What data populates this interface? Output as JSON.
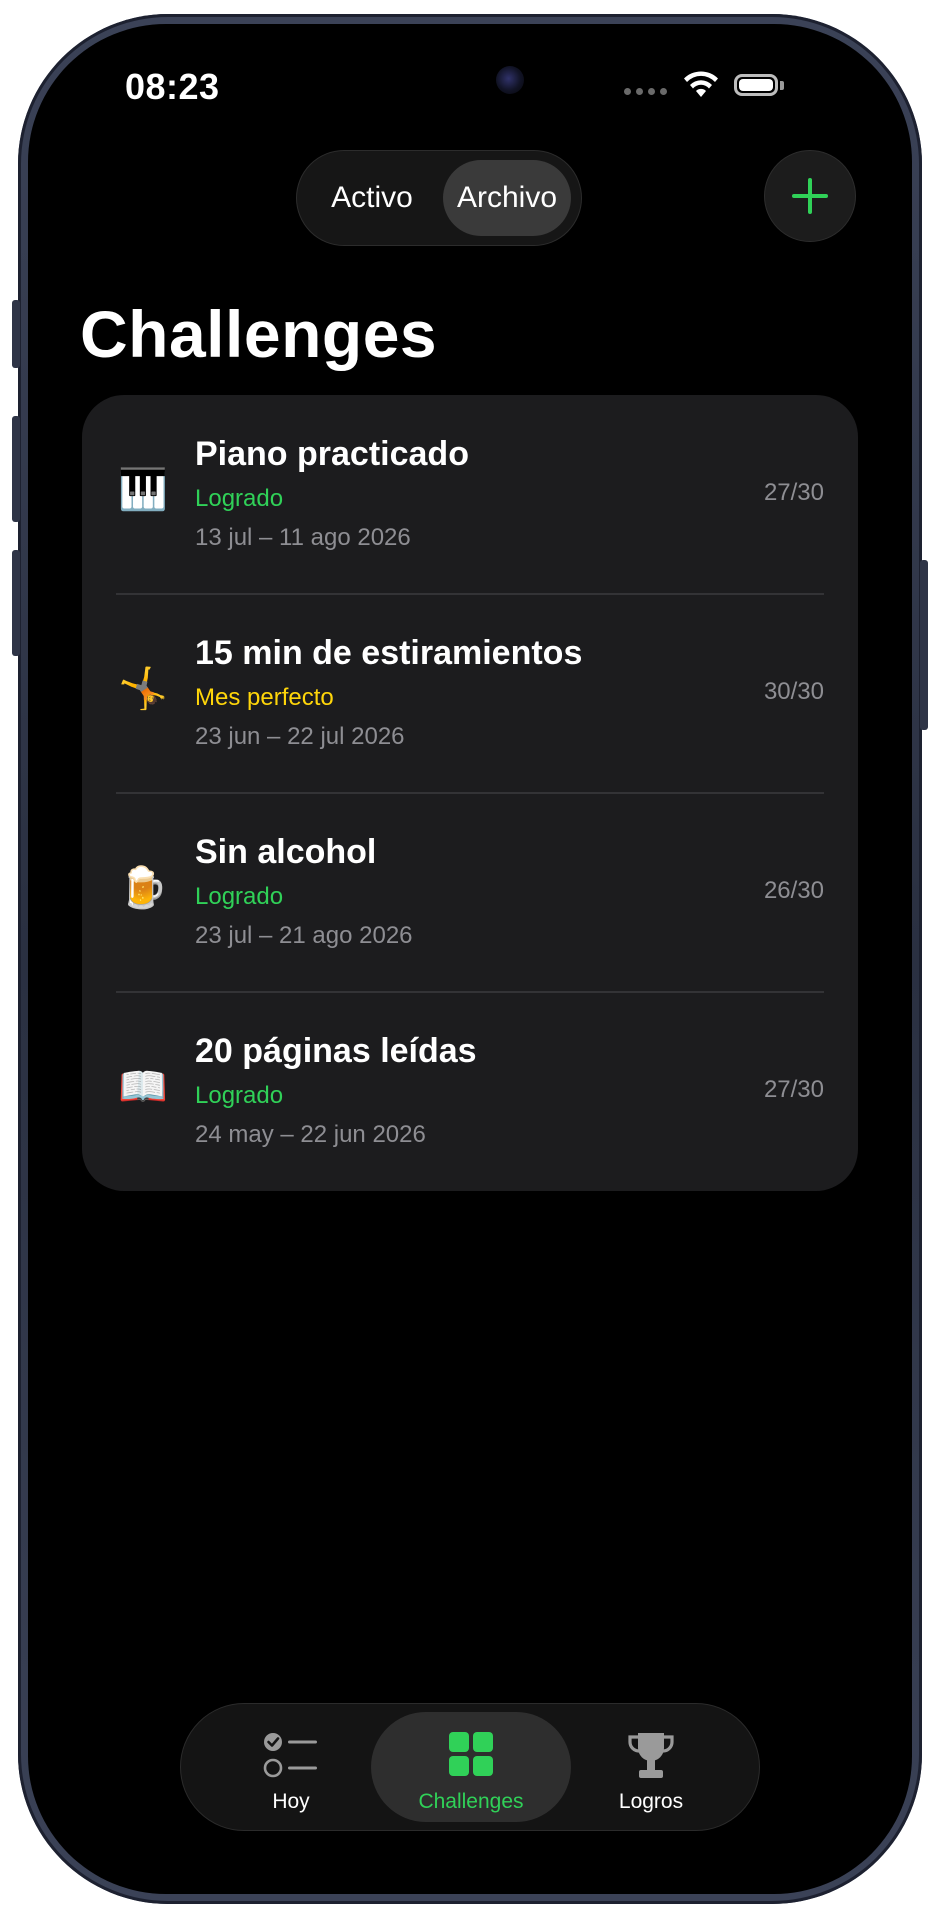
{
  "status_bar": {
    "time": "08:23"
  },
  "header": {
    "segmented": {
      "options": [
        "Activo",
        "Archivo"
      ],
      "selected": "Archivo"
    },
    "add_button_icon": "plus-icon"
  },
  "page": {
    "title": "Challenges"
  },
  "challenges": [
    {
      "icon": "piano-keyboard",
      "emoji": "🎹",
      "title": "Piano practicado",
      "status": "Logrado",
      "status_color": "#30d158",
      "dates": "13 jul – 11 ago 2026",
      "progress": "27/30"
    },
    {
      "icon": "cartwheel-person",
      "emoji": "🤸",
      "title": "15 min de estiramientos",
      "status": "Mes perfecto",
      "status_color": "#ffd60a",
      "dates": "23 jun – 22 jul 2026",
      "progress": "30/30"
    },
    {
      "icon": "beer-mug",
      "emoji": "🍺",
      "title": "Sin alcohol",
      "status": "Logrado",
      "status_color": "#30d158",
      "dates": "23 jul – 21 ago 2026",
      "progress": "26/30"
    },
    {
      "icon": "open-book",
      "emoji": "📖",
      "title": "20 páginas leídas",
      "status": "Logrado",
      "status_color": "#30d158",
      "dates": "24 may – 22 jun 2026",
      "progress": "27/30"
    }
  ],
  "tabbar": {
    "tabs": [
      {
        "label": "Hoy",
        "icon": "checklist-icon",
        "selected": false
      },
      {
        "label": "Challenges",
        "icon": "grid-icon",
        "selected": true
      },
      {
        "label": "Logros",
        "icon": "trophy-icon",
        "selected": false
      }
    ]
  },
  "colors": {
    "accent": "#30d158",
    "background": "#000000",
    "card": "#1c1c1e",
    "secondary_text": "#8e8e93"
  }
}
